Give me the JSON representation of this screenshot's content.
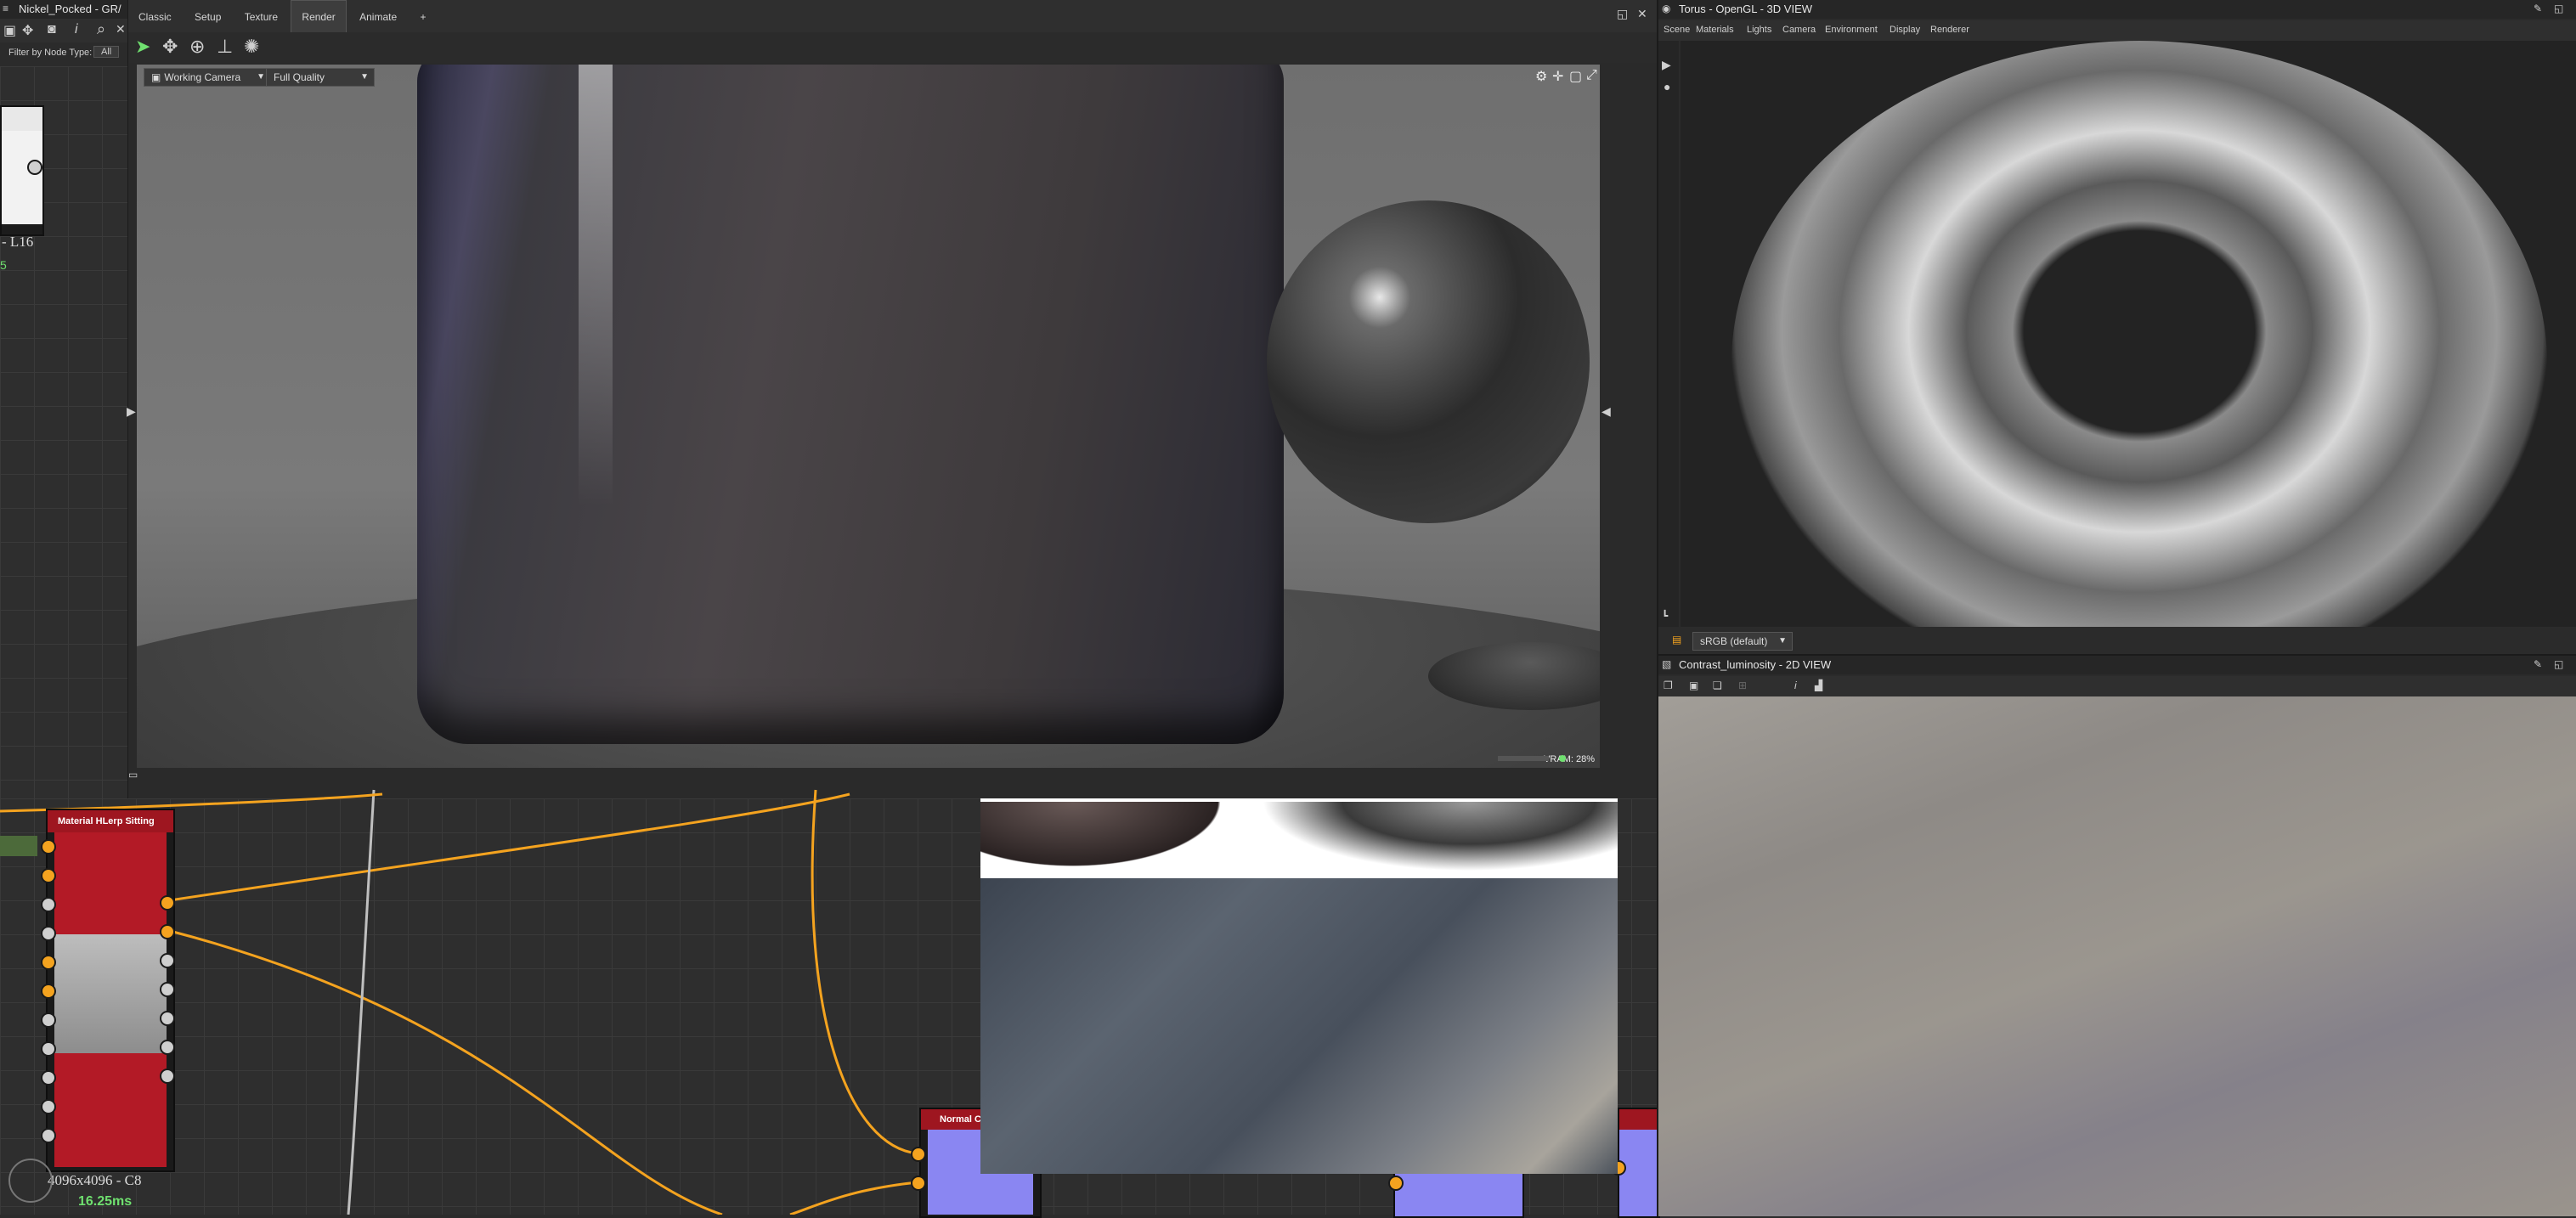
{
  "left_panel": {
    "title": "Nickel_Pocked - GR/",
    "filter_label": "Filter by Node Type:",
    "filter_value": "All",
    "node_label": "- L16",
    "status_text": "5"
  },
  "viewport3d": {
    "menu": [
      "Classic",
      "Setup",
      "Texture",
      "Render",
      "Animate",
      "+"
    ],
    "active_menu": "Render",
    "camera": "Working Camera",
    "quality": "Full Quality",
    "vram": "VRAM: 28%"
  },
  "graph": {
    "node_title": "Material HLerp Sitting",
    "node_size": "4096x4096 - C8",
    "node_time": "16.25ms",
    "normal_node_title": "Normal C"
  },
  "view3d_panel": {
    "title": "Torus - OpenGL - 3D VIEW",
    "menu": [
      "Scene",
      "Materials",
      "Lights",
      "Camera",
      "Environment",
      "Display",
      "Renderer"
    ],
    "colorspace": "sRGB (default)"
  },
  "view2d_panel": {
    "title": "Contrast_luminosity - 2D VIEW"
  },
  "colors": {
    "accent_orange": "#f4a31f",
    "node_red": "#b31a26",
    "normal_purple": "#8a86f2",
    "panel_bg": "#2b2b2b",
    "green_text": "#6fe06f"
  }
}
